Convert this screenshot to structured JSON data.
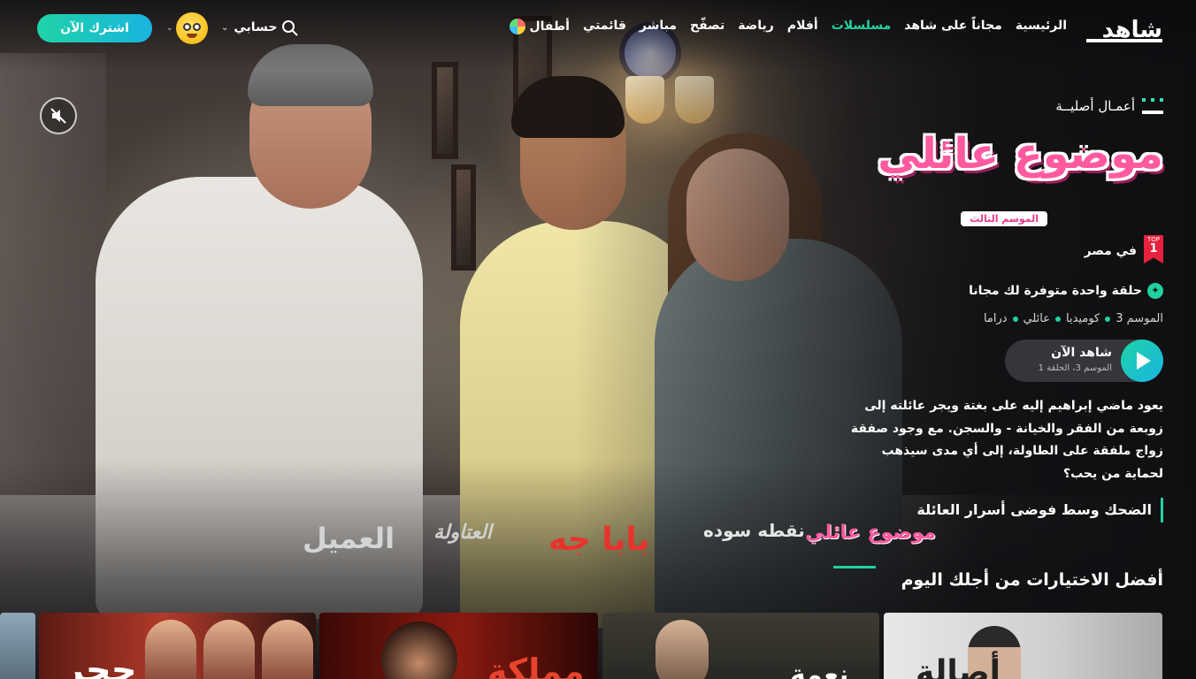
{
  "nav": {
    "brand": "شاهد",
    "items": [
      {
        "label": "الرئيسية",
        "active": false
      },
      {
        "label": "مجاناً على شاهد",
        "active": false
      },
      {
        "label": "مسلسلات",
        "active": true
      },
      {
        "label": "أفلام",
        "active": false
      },
      {
        "label": "رياضة",
        "active": false
      },
      {
        "label": "تصفّح",
        "active": false
      },
      {
        "label": "مباشر",
        "active": false
      },
      {
        "label": "قائمتي",
        "active": false
      },
      {
        "label": "أطفال",
        "active": false
      }
    ],
    "account_label": "حسابي",
    "subscribe_label": "اشترك الآن",
    "accent_color": "#21d19f"
  },
  "hero": {
    "originals_label": "أعمـال أصليــة",
    "show_title": "موضوع عائلي",
    "season_tag": "الموسم الثالث",
    "top_badge": {
      "label": "TOP",
      "rank": "1"
    },
    "rank_label": "في مصر",
    "free_episode": "حلقة واحدة متوفرة لك مجانا",
    "meta": [
      "الموسم 3",
      "كوميديا",
      "عائلي",
      "دراما"
    ],
    "watch": {
      "title": "شاهد الآن",
      "subtitle": "الموسم 3، الحلقة 1"
    },
    "description": "يعود ماضي إبراهيم إليه على بغتة ويجر عائلته إلى زوبعة من الفقر والخيانة - والسجن. مع وجود صفقة زواج ملفقة على الطاولة، إلى أي مدى سيذهب لحماية من يحب؟",
    "tagline": "الضحك وسط فوضى أسرار العائلة"
  },
  "carousel_logos": [
    "العميل",
    "العتاولة",
    "بابا جه",
    "نقطه سوده",
    "موضوع عائلي"
  ],
  "section": {
    "title": "أفضل الاختيارات من أجلك اليوم",
    "cards": [
      {
        "title": ""
      },
      {
        "title": "حجر"
      },
      {
        "title": "مملكة"
      },
      {
        "title": "نعمة"
      },
      {
        "title": "أصالة"
      }
    ]
  }
}
